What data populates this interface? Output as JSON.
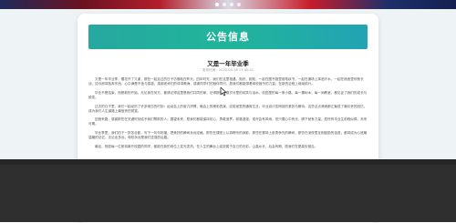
{
  "carousel": {
    "dots": 4,
    "active_index": 0
  },
  "notice": {
    "header": "公告信息",
    "title": "又是一年毕业季",
    "meta": "发布时间：2022-03-16 17:40:41",
    "paragraphs": [
      "又是一年毕业季，樱花开了又谢，那些一起走过的日子仿佛就在昨天。四年时光，我们在这里相遇、相识、相知，一起在图书馆里奋笔疾书，一起在操场上挥洒汗水，一起在宿舍里彻夜长谈。如今即将各奔东西，心中满是不舍与感激。感谢老师们的谆谆教诲，感谢同学们的相伴同行，愿我们都能带着母校赋予的力量，在新的征程上继续前行。",
      "毕业不是结束，而是新的开始。无论身在何方，都请记得这里是我们共同的家，记得那些青春岁月里的欢笑与泪水。校园里的每一条小路、每一棵树木、每一间教室，都见证了我们的成长与蜕变。",
      "过去的日子里，我们一起经历了许多难忘的时刻：运动会上的奋力拼搏，晚会上的精彩表演，实验室里的通宵达旦，毕业设计答辩前的紧张与期待。这些点点滴滴都汇聚成了最珍贵的回忆，成为我们人生道路上最宝贵的财富。",
      "回首来路，感谢那些在关键时刻给予我们帮助的人；展望未来，愿我们都能保持初心，勇敢追梦。前路漫漫，或许会有风雨，但只要心中有光，脚下就有力量。愿所有毕业生前程似锦，未来可期。",
      "毕业季里，我们拍下一张张合影，写下一句句祝福，把美好的瞬间永远定格。那些在课堂上认真聆听的身影，那些在赛场上奋勇争先的瞬间，那些在深夜里互相鼓励的话语，都将成为心底最温暖的记忆。无论走多远，母校永远是我们坚强的后盾。",
      "最后，祝愿每一位即将离开校园的同学，都能在新的岗位上发光发热，在人生的舞台上绽放属于自己的光彩。山高水长，后会有期，愿我们在更高处相见。"
    ]
  },
  "colors": {
    "header_gradient_start": "#27a8a0",
    "header_gradient_end": "#23a3b4",
    "page_background": "#eef3f6",
    "footer_background": "#2f2f2f"
  },
  "icons": {
    "cursor": "mouse-cursor-icon"
  }
}
